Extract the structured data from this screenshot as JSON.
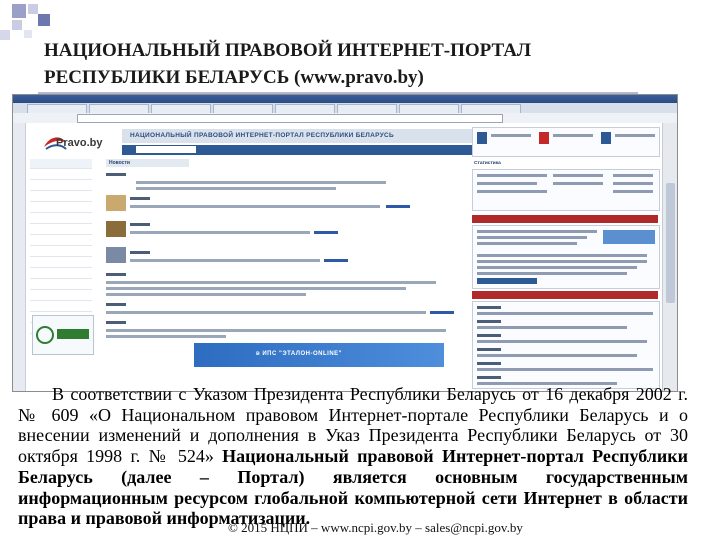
{
  "slide": {
    "title_line1": "НАЦИОНАЛЬНЫЙ ПРАВОВОЙ ИНТЕРНЕТ-ПОРТАЛ",
    "title_line2": "РЕСПУБЛИКИ БЕЛАРУСЬ (www.pravo.by)",
    "body_part1": "В соответствии с Указом Президента Республики Беларусь от 16 декабря 2002 г. № 609 «О Национальном правовом Интернет-портале Республики Беларусь и о внесении изменений и дополнения в Указ Президента Республики Беларусь от 30 октября 1998 г. № 524» ",
    "body_bold": "Национальный правовой Интернет-портал Республики Беларусь (далее – Портал) является основным государственным информационным ресурсом глобальной компьютерной сети Интернет в области права и правовой информатизации.",
    "footer": "© 2015 НЦПИ – www.ncpi.gov.by – sales@ncpi.gov.by"
  },
  "screenshot": {
    "site_logo": "Pravo.by",
    "site_banner": "НАЦИОНАЛЬНЫЙ ПРАВОВОЙ ИНТЕРНЕТ-ПОРТАЛ РЕСПУБЛИКИ БЕЛАРУСЬ",
    "news_heading": "Новости",
    "banner_text": "в ИПС \"ЭТАЛОН-ONLINE\"",
    "right_heading": "Статистика",
    "colors": {
      "accent_blue": "#2d5a94",
      "banner_blue": "#2d6cc0",
      "red": "#b12a2a"
    }
  }
}
